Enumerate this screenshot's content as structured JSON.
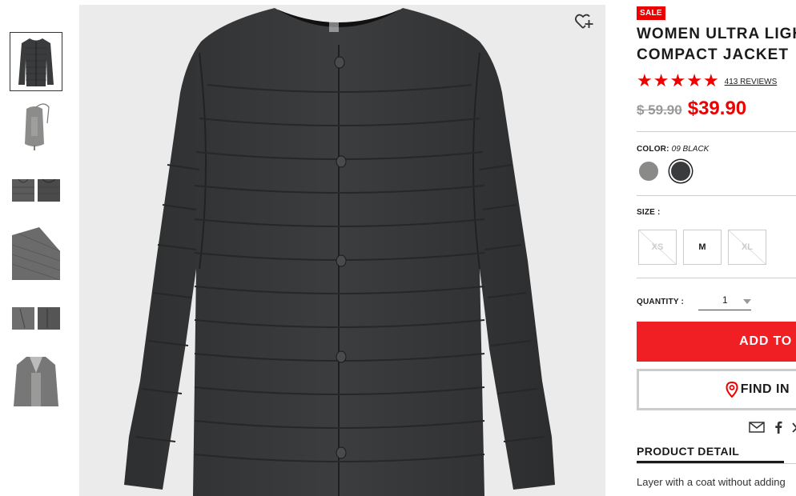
{
  "thumbnails": [
    {
      "name": "front-view",
      "active": true
    },
    {
      "name": "packed-pouch",
      "active": false
    },
    {
      "name": "collar-detail",
      "active": false
    },
    {
      "name": "fabric-detail",
      "active": false
    },
    {
      "name": "pocket-detail",
      "active": false
    },
    {
      "name": "styled-view",
      "active": false
    }
  ],
  "product": {
    "badge": "SALE",
    "title_line1": "WOMEN ULTRA LIGHT",
    "title_line2": "COMPACT JACKET",
    "rating": 5,
    "reviews": "413 REVIEWS",
    "old_price": "$ 59.90",
    "price": "$39.90",
    "color_label": "COLOR:",
    "color_value": "09 BLACK",
    "size_label": "SIZE :",
    "sizes": [
      {
        "label": "XS",
        "available": false
      },
      {
        "label": "M",
        "available": true
      },
      {
        "label": "XL",
        "available": false
      }
    ],
    "quantity_label": "QUANTITY :",
    "quantity": "1",
    "add_button": "ADD TO",
    "find_button": "FIND IN",
    "detail_heading": "PRODUCT DETAIL",
    "detail_text": "Layer with a coat without adding"
  },
  "colors": {
    "accent": "#e00000",
    "button_red": "#ef1f24",
    "swatch_gray": "#8a8a88",
    "swatch_black": "#3a3b3c"
  },
  "icons": [
    "heart-plus-icon",
    "mail-icon",
    "facebook-icon",
    "twitter-icon",
    "location-pin-icon"
  ]
}
